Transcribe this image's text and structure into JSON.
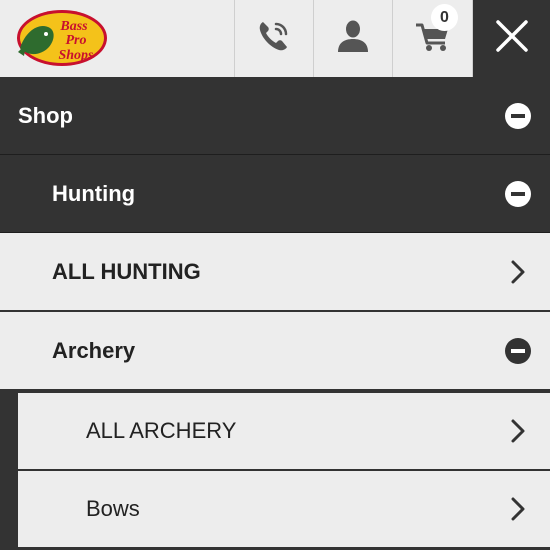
{
  "header": {
    "logo_text": [
      "Bass",
      "Pro",
      "Shops"
    ],
    "cart_count": "0",
    "icons": {
      "phone": "phone-icon",
      "account": "user-icon",
      "cart": "cart-icon",
      "close": "close-icon"
    }
  },
  "menu": {
    "shop": {
      "label": "Shop",
      "state": "expanded"
    },
    "hunting": {
      "label": "Hunting",
      "state": "expanded"
    },
    "all_hunting": {
      "label": "ALL HUNTING"
    },
    "archery": {
      "label": "Archery",
      "state": "expanded"
    },
    "archery_items": [
      {
        "label": "ALL ARCHERY"
      },
      {
        "label": "Bows"
      }
    ]
  },
  "colors": {
    "dark": "#333333",
    "light": "#ededed",
    "logo_yellow": "#f4c21a",
    "logo_red": "#c8102e"
  }
}
